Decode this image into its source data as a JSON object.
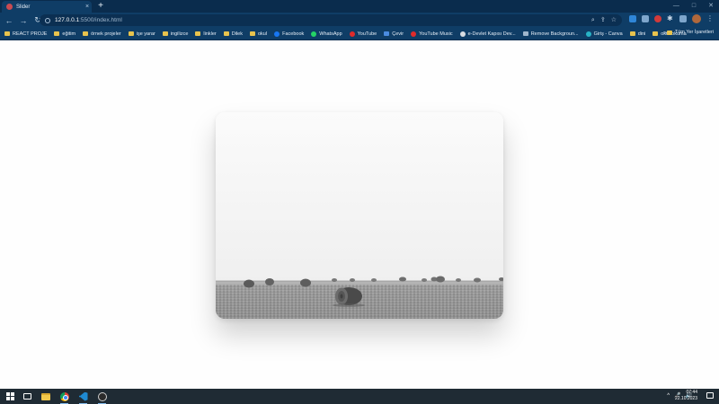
{
  "browser": {
    "tab": {
      "title": "Slider",
      "close": "×"
    },
    "new_tab": "+",
    "window_controls": [
      "—",
      "□",
      "✕"
    ],
    "nav": {
      "back": "←",
      "forward": "→",
      "reload": "↻"
    },
    "address": {
      "host": "127.0.0.1",
      "path": ":5500/index.html"
    },
    "omnibox_icons": [
      "zoom-icon",
      "share-icon",
      "star-icon"
    ],
    "extensions": [
      "extension-blue-icon",
      "extension-grey-icon",
      "extension-red-icon",
      "puzzle-icon",
      "side-panel-icon",
      "avatar",
      "menu-icon"
    ]
  },
  "bookmarks": [
    {
      "label": "REACT PROJE",
      "icon": "folder"
    },
    {
      "label": "eğitim",
      "icon": "folder"
    },
    {
      "label": "örnek projeler",
      "icon": "folder"
    },
    {
      "label": "işe yarar",
      "icon": "folder"
    },
    {
      "label": "ingilizce",
      "icon": "folder"
    },
    {
      "label": "linkler",
      "icon": "folder"
    },
    {
      "label": "Dilek",
      "icon": "folder"
    },
    {
      "label": "okul",
      "icon": "folder"
    },
    {
      "label": "Facebook",
      "icon": "fb"
    },
    {
      "label": "WhatsApp",
      "icon": "wa"
    },
    {
      "label": "YouTube",
      "icon": "yt"
    },
    {
      "label": "Çevir",
      "icon": "tr"
    },
    {
      "label": "YouTube Music",
      "icon": "ytm"
    },
    {
      "label": "e-Devlet Kapısı Dev...",
      "icon": "ed"
    },
    {
      "label": "Remove Backgroun...",
      "icon": "rb"
    },
    {
      "label": "Giriş - Canva",
      "icon": "canva"
    },
    {
      "label": "dini",
      "icon": "folder"
    },
    {
      "label": "okul-okuma",
      "icon": "folder"
    }
  ],
  "bookmarks_more": "»",
  "bookmarks_all": "Tüm Yer İşaretleri",
  "taskbar": {
    "apps": [
      "start-icon",
      "task-view-icon",
      "file-explorer-icon",
      "chrome-icon",
      "vscode-icon",
      "obs-icon"
    ],
    "tray": [
      "^",
      "🎤",
      "🔊"
    ],
    "time": "07:44",
    "date": "22.10.2023"
  },
  "colors": {
    "titlebar": "#0a2c4d",
    "toolbar": "#0f3d66",
    "taskbar": "#1f2b34",
    "page_background": "#fefefe"
  }
}
